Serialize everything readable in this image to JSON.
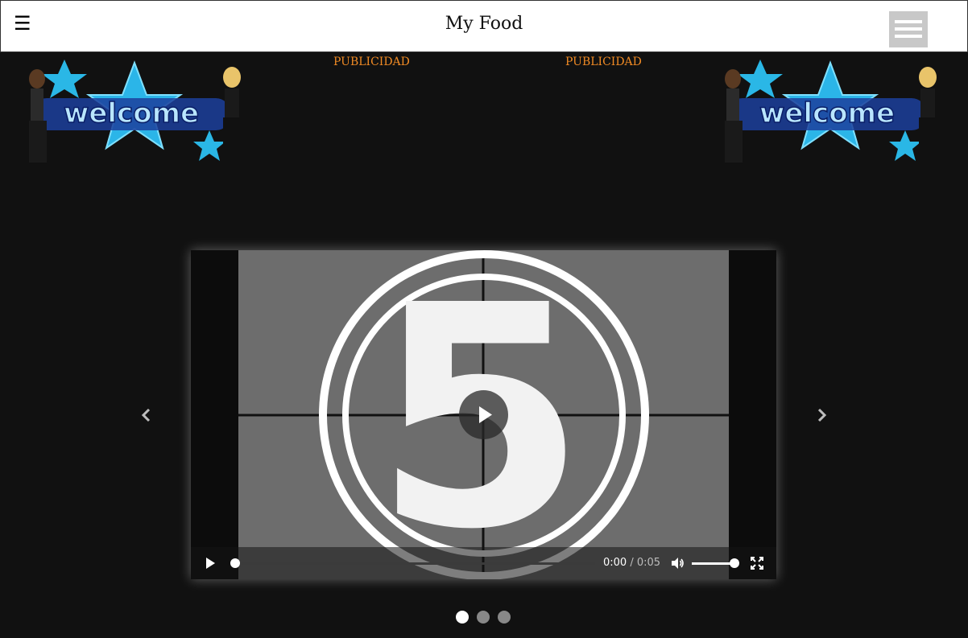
{
  "header": {
    "menu_glyph": "☰",
    "title": "My Food",
    "menu_button_icon": "hamburger-menu-icon"
  },
  "ads": [
    "PUBLICIDAD",
    "PUBLICIDAD"
  ],
  "banners": [
    {
      "icon": "welcome-banner-image"
    },
    {
      "icon": "welcome-banner-image"
    }
  ],
  "colors": {
    "background": "#111111",
    "ad_text": "#f08a24",
    "header_bg": "#ffffff",
    "menu_button": "#c8c8c8",
    "video_frame": "#6d6d6d"
  },
  "video": {
    "countdown_number": "5",
    "current_time": "0:00",
    "separator": "/",
    "duration": "0:05",
    "progress_fraction": 0.0,
    "volume_fraction": 1.0
  },
  "carousel": {
    "prev_icon": "chevron-left-icon",
    "next_icon": "chevron-right-icon",
    "slide_count": 3,
    "active_index": 0
  }
}
